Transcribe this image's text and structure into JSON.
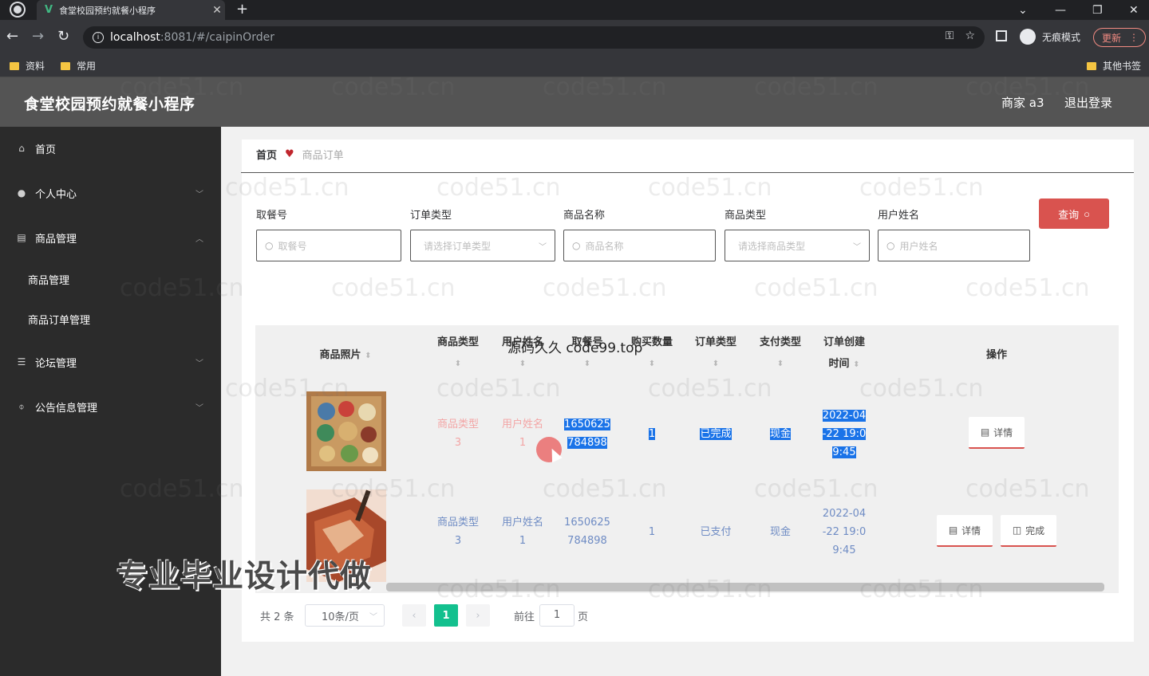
{
  "browser": {
    "tab_title": "食堂校园预约就餐小程序",
    "url_host": "localhost",
    "url_rest": ":8081/#/caipinOrder",
    "incognito_label": "无痕模式",
    "update_label": "更新",
    "bookmarks": [
      "资料",
      "常用"
    ],
    "other_bookmarks": "其他书签"
  },
  "header": {
    "title": "食堂校园预约就餐小程序",
    "user": "商家 a3",
    "logout": "退出登录"
  },
  "sidebar": {
    "items": [
      {
        "label": "首页",
        "icon": "home-icon"
      },
      {
        "label": "个人中心",
        "icon": "user-icon"
      },
      {
        "label": "商品管理",
        "icon": "chat-icon"
      },
      {
        "label": "商品管理",
        "icon": ""
      },
      {
        "label": "商品订单管理",
        "icon": ""
      },
      {
        "label": "论坛管理",
        "icon": "list-icon"
      },
      {
        "label": "公告信息管理",
        "icon": "mic-icon"
      }
    ]
  },
  "breadcrumb": {
    "home": "首页",
    "current": "商品订单"
  },
  "filters": [
    {
      "label": "取餐号",
      "placeholder": "取餐号",
      "type": "input"
    },
    {
      "label": "订单类型",
      "placeholder": "请选择订单类型",
      "type": "select"
    },
    {
      "label": "商品名称",
      "placeholder": "商品名称",
      "type": "input"
    },
    {
      "label": "商品类型",
      "placeholder": "请选择商品类型",
      "type": "select"
    },
    {
      "label": "用户姓名",
      "placeholder": "用户姓名",
      "type": "input"
    }
  ],
  "query_button": "查询",
  "table": {
    "columns": [
      "商品照片",
      "商品类型",
      "用户姓名",
      "取餐号",
      "购买数量",
      "订单类型",
      "支付类型",
      "订单创建",
      "时间",
      "操作"
    ],
    "rows": [
      {
        "type_line1": "商品类型",
        "type_line2": "3",
        "user_line1": "用户姓名",
        "user_line2": "1",
        "code_line1": "1650625",
        "code_line2": "784898",
        "qty": "1",
        "order_type": "已完成",
        "pay_type": "现金",
        "time_line1": "2022-04",
        "time_line2": "-22 19:0",
        "time_line3": "9:45",
        "actions": [
          "详情"
        ]
      },
      {
        "type_line1": "商品类型",
        "type_line2": "3",
        "user_line1": "用户姓名",
        "user_line2": "1",
        "code_line1": "1650625",
        "code_line2": "784898",
        "qty": "1",
        "order_type": "已支付",
        "pay_type": "现金",
        "time_line1": "2022-04",
        "time_line2": "-22 19:0",
        "time_line3": "9:45",
        "actions": [
          "详情",
          "完成"
        ]
      }
    ]
  },
  "pagination": {
    "total": "共 2 条",
    "page_size": "10条/页",
    "current": "1",
    "goto_label": "前往",
    "goto_value": "1",
    "goto_unit": "页"
  },
  "overlays": {
    "watermark": "code51.cn",
    "top_text": "源码久久 code99.top",
    "big_text": "专业毕业设计代做"
  },
  "colors": {
    "header_bg": "#545454",
    "sidebar_bg": "#2b2b2b",
    "query_btn": "#d9534f",
    "page_active": "#13c08e",
    "selection": "#1a73e8"
  }
}
